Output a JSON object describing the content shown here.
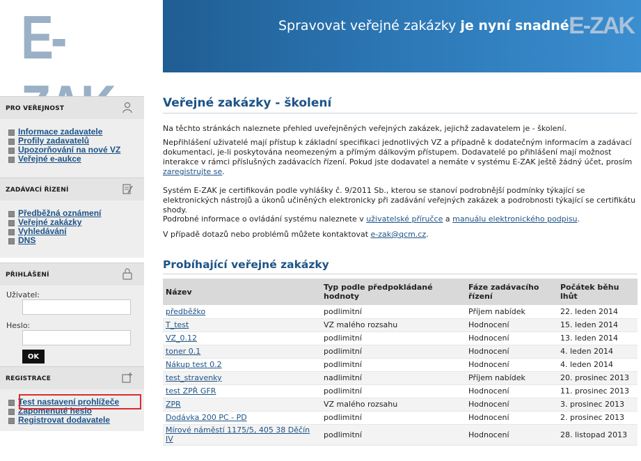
{
  "brand": {
    "logo": "E-ZAK",
    "header_logo": "E-ZAK"
  },
  "header": {
    "slogan_regular": "Spravovat veřejné zakázky ",
    "slogan_bold": "je nyní snadné"
  },
  "sidebar": {
    "public": {
      "title": "PRO VEŘEJNOST",
      "items": [
        {
          "label": "Informace zadavatele"
        },
        {
          "label": "Profily zadavatelů"
        },
        {
          "label": "Upozorňování na nové VZ"
        },
        {
          "label": "Veřejné e-aukce"
        }
      ]
    },
    "procedures": {
      "title": "ZADÁVACÍ ŘÍZENÍ",
      "items": [
        {
          "label": "Předběžná oznámení"
        },
        {
          "label": "Veřejné zakázky"
        },
        {
          "label": "Vyhledávání"
        },
        {
          "label": "DNS"
        }
      ]
    },
    "login": {
      "title": "PŘIHLÁŠENÍ",
      "user_label": "Uživatel:",
      "user_value": "",
      "password_label": "Heslo:",
      "password_value": "",
      "ok_label": "OK"
    },
    "registration": {
      "title": "REGISTRACE",
      "items": [
        {
          "label": "Test nastavení prohlížeče"
        },
        {
          "label": "Zapomenuté heslo"
        },
        {
          "label": "Registrovat dodavatele"
        }
      ]
    }
  },
  "main": {
    "title": "Veřejné zakázky - školení",
    "p1": "Na těchto stránkách naleznete přehled uveřejněných veřejných zakázek, jejichž zadavatelem je - školení.",
    "p2_text": "Nepřihlášení uživatelé mají přístup k základní specifikaci jednotlivých VZ a případně k dodatečným informacím a zadávací dokumentaci, je-li poskytována neomezeným a přímým dálkovým přístupem. Dodavatelé po přihlášení mají možnost interakce v rámci příslušných zadávacích řízení. Pokud jste dodavatel a nemáte v systému E-ZAK ještě žádný účet, prosím ",
    "p2_link": "zaregistrujte se",
    "p2_end": ".",
    "p3": "Systém E-ZAK je certifikován podle vyhlášky č. 9/2011 Sb., kterou se stanoví podrobnější podmínky týkající se elektronických nástrojů a úkonů učiněných elektronicky při zadávání veřejných zakázek a podrobnosti týkající se certifikátu shody.",
    "p4_a": "Podrobné informace o ovládání systému naleznete v ",
    "p4_link1": "uživatelské příručce",
    "p4_b": " a ",
    "p4_link2": "manuálu elektronického podpisu",
    "p4_c": ".",
    "p5_a": "V případě dotazů nebo problémů můžete kontaktovat ",
    "p5_link": "e-zak@qcm.cz",
    "p5_b": ".",
    "table_title": "Probíhající veřejné zakázky",
    "table": {
      "headers": [
        "Název",
        "Typ podle předpokládané hodnoty",
        "Fáze zadávacího řízení",
        "Počátek běhu lhůt"
      ],
      "rows": [
        [
          "předběžko",
          "podlimitní",
          "Příjem nabídek",
          "22. leden 2014"
        ],
        [
          "T_test",
          "VZ malého rozsahu",
          "Hodnocení",
          "15. leden 2014"
        ],
        [
          "VZ_0.12",
          "podlimitní",
          "Hodnocení",
          "13. leden 2014"
        ],
        [
          "toner 0.1",
          "podlimitní",
          "Hodnocení",
          "4. leden 2014"
        ],
        [
          "Nákup test 0.2",
          "podlimitní",
          "Hodnocení",
          "4. leden 2014"
        ],
        [
          "test_stravenky",
          "nadlimitní",
          "Příjem nabídek",
          "20. prosinec 2013"
        ],
        [
          "test ZPŘ GFR",
          "podlimitní",
          "Hodnocení",
          "11. prosinec 2013"
        ],
        [
          "ZPR",
          "VZ malého rozsahu",
          "Hodnocení",
          "3. prosinec 2013"
        ],
        [
          "Dodávka 200 PC - PD",
          "podlimitní",
          "Hodnocení",
          "2. prosinec 2013"
        ],
        [
          "Mírové náměstí 1175/5, 405 38 Děčín IV",
          "podlimitní",
          "Hodnocení",
          "28. listopad 2013"
        ]
      ]
    }
  }
}
